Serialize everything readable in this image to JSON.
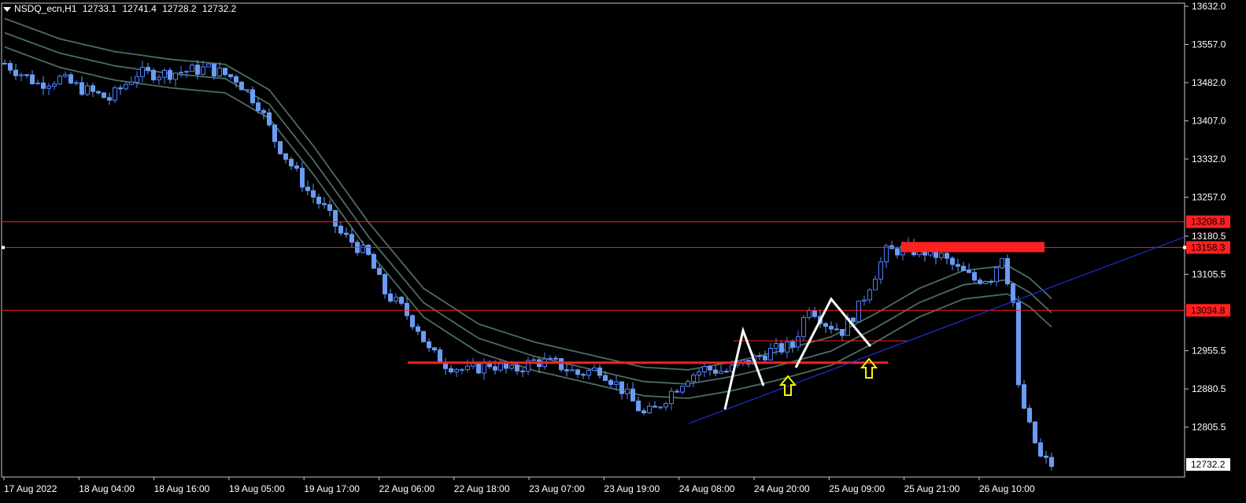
{
  "header": {
    "symbol": "NSDQ_ecn,H1",
    "open": "12733.1",
    "high": "12741.4",
    "low": "12728.2",
    "close": "12732.2"
  },
  "colors": {
    "background": "#000000",
    "bull": "#4f7fff",
    "bear": "#6a9cf5",
    "ma": "#4b6e63",
    "level": "#ff2020",
    "pattern": "#ffffff",
    "signal": "#f5f500",
    "trend": "#1f2fd6"
  },
  "chart_data": {
    "type": "candlestick",
    "ylim": [
      12732.2,
      13632.0
    ],
    "y_ticks": [
      "13632.0",
      "13557.0",
      "13482.0",
      "13407.0",
      "13332.0",
      "13257.0",
      "13180.5",
      "13105.5",
      "12955.5",
      "12880.5",
      "12805.5"
    ],
    "x_ticks": [
      "17 Aug 2022",
      "18 Aug 04:00",
      "18 Aug 16:00",
      "19 Aug 05:00",
      "19 Aug 17:00",
      "22 Aug 06:00",
      "22 Aug 18:00",
      "23 Aug 07:00",
      "23 Aug 19:00",
      "24 Aug 08:00",
      "24 Aug 20:00",
      "25 Aug 09:00",
      "25 Aug 21:00",
      "26 Aug 10:00"
    ],
    "level_labels": [
      {
        "price": 13208.8,
        "text": "13208.8"
      },
      {
        "price": 13158.3,
        "text": "13158.3"
      },
      {
        "price": 13034.8,
        "text": "13034.8"
      }
    ],
    "current_price_label": "12732.2",
    "close_path": [
      [
        0,
        13520
      ],
      [
        6,
        13480
      ],
      [
        10,
        13490
      ],
      [
        14,
        13470
      ],
      [
        19,
        13450
      ],
      [
        24,
        13500
      ],
      [
        29,
        13500
      ],
      [
        33,
        13505
      ],
      [
        37,
        13510
      ],
      [
        42,
        13490
      ],
      [
        46,
        13440
      ],
      [
        49,
        13370
      ],
      [
        52,
        13320
      ],
      [
        55,
        13270
      ],
      [
        58,
        13235
      ],
      [
        61,
        13185
      ],
      [
        63,
        13170
      ],
      [
        66,
        13140
      ],
      [
        69,
        13070
      ],
      [
        72,
        13040
      ],
      [
        75,
        13000
      ],
      [
        77,
        12955
      ],
      [
        80,
        12930
      ],
      [
        84,
        12915
      ],
      [
        88,
        12930
      ],
      [
        92,
        12915
      ],
      [
        96,
        12935
      ],
      [
        100,
        12930
      ],
      [
        104,
        12910
      ],
      [
        108,
        12920
      ],
      [
        112,
        12880
      ],
      [
        116,
        12830
      ],
      [
        118,
        12840
      ],
      [
        121,
        12875
      ],
      [
        124,
        12905
      ],
      [
        127,
        12920
      ],
      [
        131,
        12915
      ],
      [
        135,
        12935
      ],
      [
        139,
        12955
      ],
      [
        143,
        12965
      ],
      [
        146,
        13045
      ],
      [
        149,
        13010
      ],
      [
        152,
        12995
      ],
      [
        155,
        13040
      ],
      [
        157,
        13085
      ],
      [
        160,
        13150
      ],
      [
        163,
        13155
      ],
      [
        167,
        13150
      ],
      [
        170,
        13140
      ],
      [
        173,
        13115
      ],
      [
        176,
        13095
      ],
      [
        179,
        13100
      ],
      [
        181,
        13145
      ],
      [
        183,
        13050
      ],
      [
        184,
        12880
      ],
      [
        186,
        12805
      ],
      [
        188,
        12745
      ],
      [
        190,
        12732
      ]
    ],
    "ma_path": [
      [
        0,
        13580
      ],
      [
        10,
        13540
      ],
      [
        20,
        13515
      ],
      [
        30,
        13500
      ],
      [
        40,
        13490
      ],
      [
        48,
        13440
      ],
      [
        56,
        13330
      ],
      [
        66,
        13180
      ],
      [
        76,
        13050
      ],
      [
        86,
        12980
      ],
      [
        96,
        12945
      ],
      [
        106,
        12920
      ],
      [
        116,
        12895
      ],
      [
        124,
        12890
      ],
      [
        132,
        12905
      ],
      [
        140,
        12925
      ],
      [
        150,
        12955
      ],
      [
        158,
        13000
      ],
      [
        166,
        13050
      ],
      [
        174,
        13085
      ],
      [
        182,
        13095
      ],
      [
        186,
        13070
      ],
      [
        190,
        13030
      ]
    ],
    "support_zone_price": 12932,
    "resistance_zone_price": 13158.3,
    "trendline": {
      "from": [
        126,
        12812
      ],
      "to": [
        230,
        13183
      ]
    },
    "signals": [
      {
        "i": 144,
        "price": 12885
      },
      {
        "i": 159,
        "price": 12900
      }
    ]
  }
}
